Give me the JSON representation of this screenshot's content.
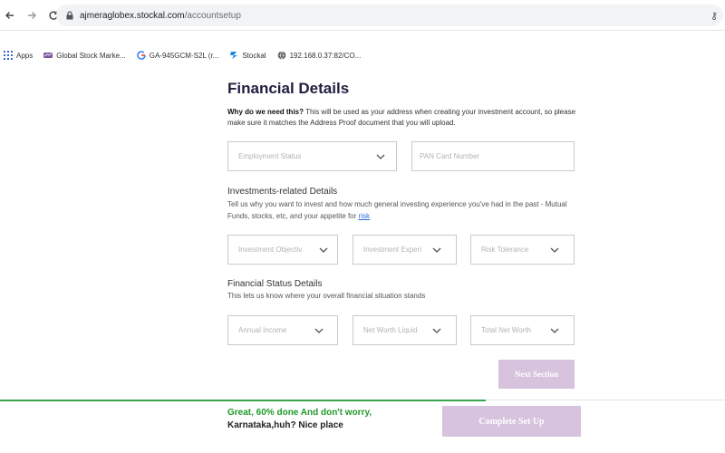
{
  "browser": {
    "url_host": "ajmeraglobex.stockal.com",
    "url_path": "/accountsetup",
    "bookmarks": [
      {
        "label": "Apps",
        "icon": "apps-grid-icon"
      },
      {
        "label": "Global Stock Marke...",
        "icon": "globe-stock-icon"
      },
      {
        "label": "GA-945GCM-S2L (r...",
        "icon": "google-icon"
      },
      {
        "label": "Stockal",
        "icon": "stockal-icon"
      },
      {
        "label": "192.168.0.37:82/CO...",
        "icon": "globe-icon"
      }
    ]
  },
  "page": {
    "title": "Financial Details",
    "why_bold": "Why do we need this?",
    "why_text": " This will be used as your address when creating your investment account, so please make sure it matches the Address Proof document that you will upload."
  },
  "personal": {
    "employment_status": "Employment Status",
    "pan_placeholder": "PAN Card Number"
  },
  "investments": {
    "title": "Investments-related Details",
    "subtitle": "Tell us why you want to invest and how much general investing experience you've had in the past - Mutual Funds, stocks, etc, and your appetite for ",
    "risk_link": "risk",
    "objective": "Investment Objectiv",
    "experience": "Investment Experi",
    "risk_tolerance": "Risk Tolerance"
  },
  "financial_status": {
    "title": "Financial Status Details",
    "subtitle": "This lets us know where your overall financial situation stands",
    "annual_income": "Annual Income",
    "net_worth_liquid": "Net Worth Liquid",
    "total_net_worth": "Total Net Worth"
  },
  "actions": {
    "next_section": "Next Section",
    "complete_setup": "Complete Set Up"
  },
  "footer": {
    "progress_fraction": 0.67,
    "message_green": "Great, 60% done And don't worry,",
    "message_dark": "Karnataka,huh? Nice place"
  },
  "colors": {
    "accent_button": "#d7c3de",
    "progress": "#3aa54a",
    "success_text": "#219a2a"
  }
}
